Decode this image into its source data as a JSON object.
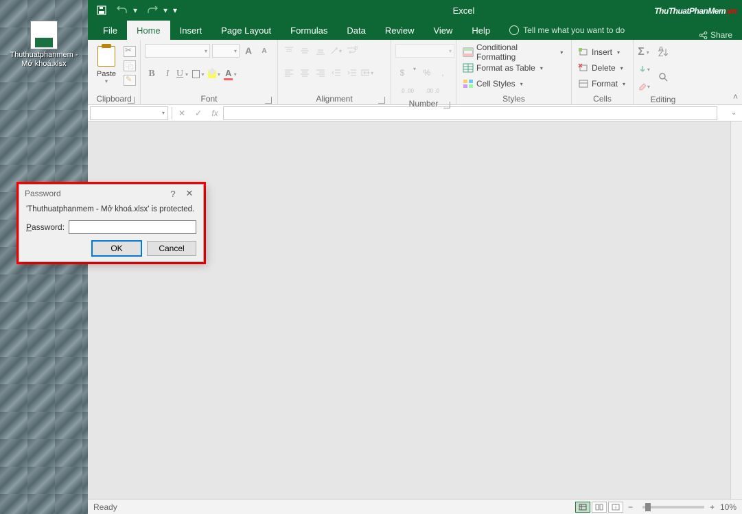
{
  "desktop": {
    "file_icon_label": "Thuthuatphanmem - Mở khoá.xlsx"
  },
  "watermark": {
    "main": "ThuThuatPhanMem",
    "domain": ".vn"
  },
  "titlebar": {
    "app_title": "Excel"
  },
  "tabs": {
    "file": "File",
    "home": "Home",
    "insert": "Insert",
    "page_layout": "Page Layout",
    "formulas": "Formulas",
    "data": "Data",
    "review": "Review",
    "view": "View",
    "help": "Help",
    "tellme": "Tell me what you want to do",
    "share": "Share"
  },
  "ribbon": {
    "clipboard": {
      "paste": "Paste",
      "label": "Clipboard"
    },
    "font": {
      "label": "Font",
      "bold": "B",
      "italic": "I",
      "underline": "U",
      "grow": "A",
      "shrink": "A",
      "color_letter": "A"
    },
    "alignment": {
      "label": "Alignment"
    },
    "number": {
      "label": "Number",
      "currency": "$",
      "percent": "%",
      "comma": ",",
      "inc": ".0  .00",
      "dec": ".00  .0"
    },
    "styles": {
      "cond": "Conditional Formatting",
      "table": "Format as Table",
      "cell": "Cell Styles",
      "label": "Styles"
    },
    "cells": {
      "insert": "Insert",
      "delete": "Delete",
      "format": "Format",
      "label": "Cells"
    },
    "editing": {
      "label": "Editing"
    }
  },
  "formula_bar": {
    "fx": "fx",
    "cancel": "✕",
    "enter": "✓"
  },
  "dialog": {
    "title": "Password",
    "message": "'Thuthuatphanmem - Mở khoá.xlsx' is protected.",
    "password_label_underline": "P",
    "password_label_rest": "assword:",
    "ok": "OK",
    "cancel": "Cancel",
    "help": "?",
    "close": "✕"
  },
  "statusbar": {
    "ready": "Ready",
    "zoom_minus": "−",
    "zoom_plus": "+",
    "zoom_pct": "10%"
  }
}
